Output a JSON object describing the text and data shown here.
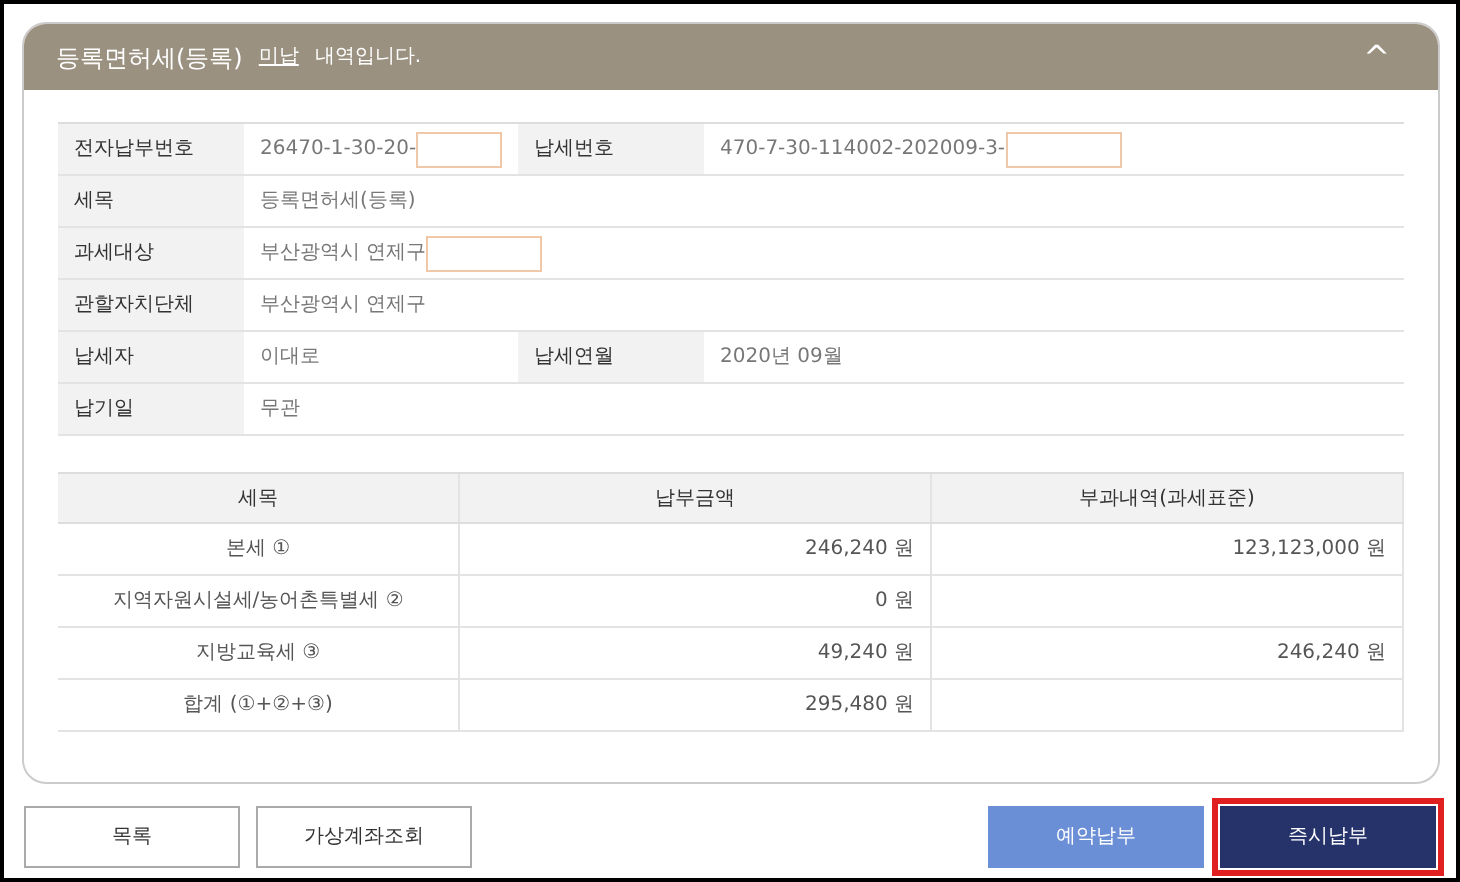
{
  "header": {
    "title": "등록면허세(등록)",
    "status": "미납",
    "suffix": "내역입니다.",
    "expanded": true,
    "toggle_icon": "^"
  },
  "info_rows": [
    {
      "cells": [
        {
          "label": "전자납부번호",
          "value": "26470-1-30-20-",
          "masked": true
        },
        {
          "label": "납세번호",
          "value": "470-7-30-114002-202009-3-",
          "masked": true
        }
      ]
    },
    {
      "cells": [
        {
          "label": "세목",
          "value": "등록면허세(등록)",
          "masked": false
        }
      ]
    },
    {
      "cells": [
        {
          "label": "과세대상",
          "value": "부산광역시 연제구",
          "masked": true
        }
      ]
    },
    {
      "cells": [
        {
          "label": "관할자치단체",
          "value": "부산광역시 연제구",
          "masked": false
        }
      ]
    },
    {
      "cells": [
        {
          "label": "납세자",
          "value": "이대로",
          "masked": false
        },
        {
          "label": "납세연월",
          "value": "2020년 09월",
          "masked": false
        }
      ]
    },
    {
      "cells": [
        {
          "label": "납기일",
          "value": "무관",
          "masked": false
        }
      ]
    }
  ],
  "tax_table": {
    "columns": [
      "세목",
      "납부금액",
      "부과내역(과세표준)"
    ],
    "rows": [
      [
        "본세 ①",
        "246,240 원",
        "123,123,000 원"
      ],
      [
        "지역자원시설세/농어촌특별세 ②",
        "0 원",
        ""
      ],
      [
        "지방교육세 ③",
        "49,240 원",
        "246,240 원"
      ],
      [
        "합계 (①+②+③)",
        "295,480 원",
        ""
      ]
    ]
  },
  "buttons": [
    {
      "label": "목록",
      "kind": "outline",
      "highlighted": false
    },
    {
      "label": "가상계좌조회",
      "kind": "outline",
      "highlighted": false
    },
    {
      "label": "예약납부",
      "kind": "light",
      "highlighted": false
    },
    {
      "label": "즉시납부",
      "kind": "dark",
      "highlighted": true
    }
  ]
}
